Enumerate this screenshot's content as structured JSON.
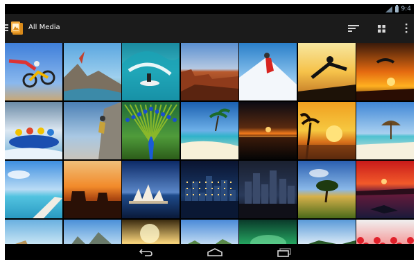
{
  "status_bar": {
    "time": "9:4",
    "icons": [
      "no-sim-icon",
      "battery-icon"
    ]
  },
  "action_bar": {
    "title": "All Media",
    "icons": [
      "home-up-icon",
      "gallery-app-icon",
      "sort-icon",
      "grid-view-icon",
      "overflow-menu-icon"
    ]
  },
  "navigation_bar": {
    "icons": [
      "back-icon",
      "home-icon",
      "recent-apps-icon"
    ]
  },
  "colors": {
    "background": "#000000",
    "action_bar": "#1b1b1b",
    "icon": "#d8d8d8",
    "status_icon": "#9fb5c8"
  },
  "grid": {
    "columns": 7,
    "visible_rows": 4,
    "thumbnails": [
      {
        "name": "motocross-jump",
        "theme": "moto"
      },
      {
        "name": "cliff-climber",
        "theme": "cliff"
      },
      {
        "name": "surfer-wave",
        "theme": "surf"
      },
      {
        "name": "canyon",
        "theme": "canyon"
      },
      {
        "name": "ice-climber",
        "theme": "ice"
      },
      {
        "name": "silhouette-jump",
        "theme": "jump"
      },
      {
        "name": "paraglider-sunset",
        "theme": "paraglide"
      },
      {
        "name": "rafting",
        "theme": "raft"
      },
      {
        "name": "rock-climber",
        "theme": "climb"
      },
      {
        "name": "peacock",
        "theme": "peacock"
      },
      {
        "name": "tropical-island",
        "theme": "island"
      },
      {
        "name": "dark-sunset-sea",
        "theme": "darksea"
      },
      {
        "name": "palm-sunset",
        "theme": "palmsunset"
      },
      {
        "name": "beach-umbrella",
        "theme": "umbrella"
      },
      {
        "name": "pier-sky",
        "theme": "pier"
      },
      {
        "name": "desert-mesa-sunset",
        "theme": "mesa"
      },
      {
        "name": "opera-house",
        "theme": "opera"
      },
      {
        "name": "city-night",
        "theme": "city"
      },
      {
        "name": "skyscrapers-dusk",
        "theme": "skyline"
      },
      {
        "name": "savanna-tree",
        "theme": "tree"
      },
      {
        "name": "red-sunset-coast",
        "theme": "redcoast"
      },
      {
        "name": "rocky-coast",
        "theme": "rocks"
      },
      {
        "name": "mountain-lake",
        "theme": "mountain"
      },
      {
        "name": "sunlit-field",
        "theme": "sunfield"
      },
      {
        "name": "river-valley",
        "theme": "valley"
      },
      {
        "name": "green-abstract",
        "theme": "green"
      },
      {
        "name": "lagoon-hut",
        "theme": "lagoon"
      },
      {
        "name": "red-flowers",
        "theme": "flowers"
      }
    ]
  }
}
